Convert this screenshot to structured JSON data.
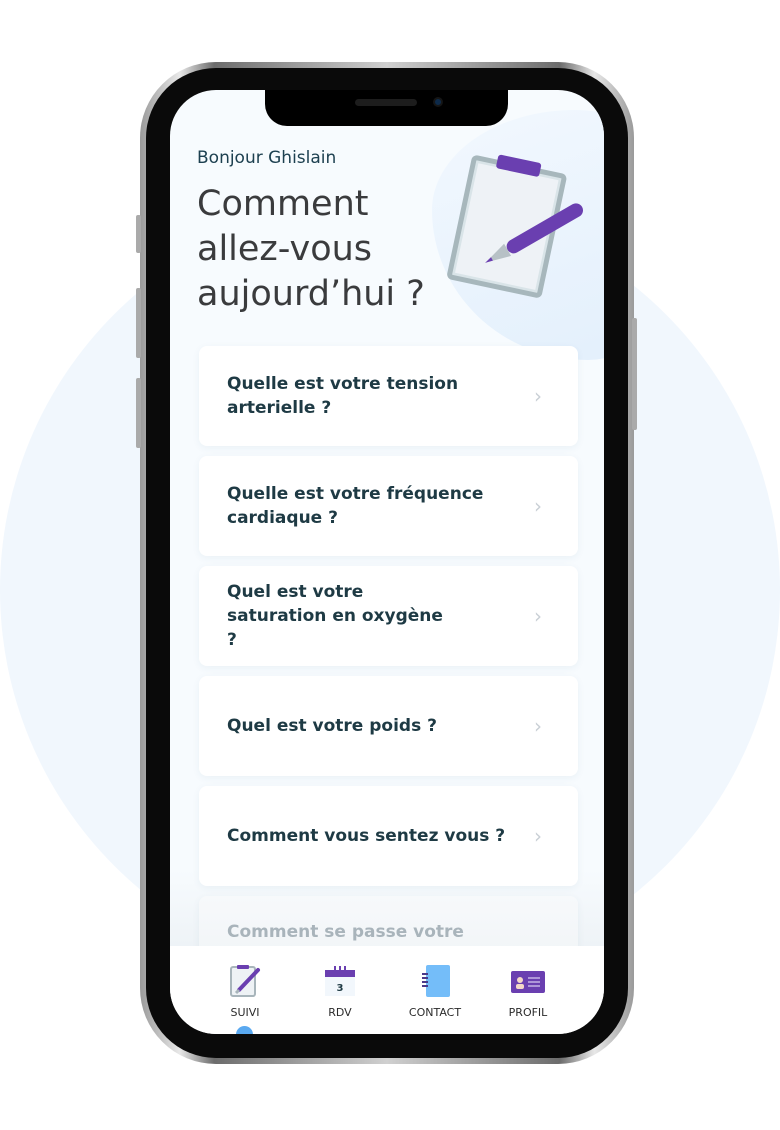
{
  "header": {
    "greeting": "Bonjour Ghislain",
    "title": "Comment allez-vous aujourd’hui ?"
  },
  "questions": [
    {
      "label": "Quelle est votre tension arterielle ?"
    },
    {
      "label": "Quelle est votre fréquence cardiaque ?"
    },
    {
      "label": "Quel est votre saturation en oxygène ?"
    },
    {
      "label": "Quel est votre poids ?"
    },
    {
      "label": "Comment vous sentez vous ?"
    },
    {
      "label": "Comment se passe votre"
    }
  ],
  "nav": {
    "items": [
      {
        "label": "SUIVI",
        "icon": "clipboard-pen-icon",
        "active": true
      },
      {
        "label": "RDV",
        "icon": "calendar-icon",
        "calendar_day": "3"
      },
      {
        "label": "CONTACT",
        "icon": "notebook-icon"
      },
      {
        "label": "PROFIL",
        "icon": "id-card-icon"
      }
    ]
  },
  "colors": {
    "accent": "#6a3fb0",
    "active_dot": "#5aa9f0",
    "text": "#1e3a44"
  }
}
